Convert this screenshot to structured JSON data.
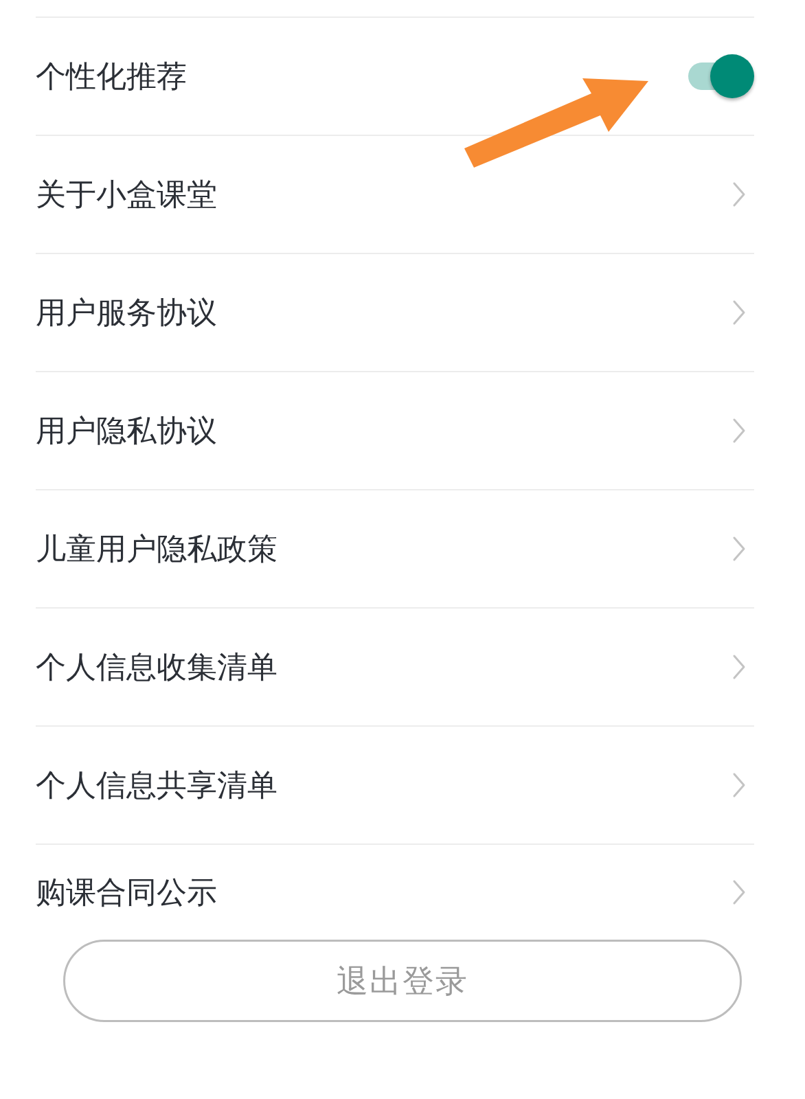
{
  "settings": [
    {
      "kind": "toggle",
      "label": "个性化推荐",
      "on": true
    },
    {
      "kind": "link",
      "label": "关于小盒课堂"
    },
    {
      "kind": "link",
      "label": "用户服务协议"
    },
    {
      "kind": "link",
      "label": "用户隐私协议"
    },
    {
      "kind": "link",
      "label": "儿童用户隐私政策"
    },
    {
      "kind": "link",
      "label": "个人信息收集清单"
    },
    {
      "kind": "link",
      "label": "个人信息共享清单"
    },
    {
      "kind": "link",
      "label": "购课合同公示"
    }
  ],
  "logout_button": "退出登录"
}
